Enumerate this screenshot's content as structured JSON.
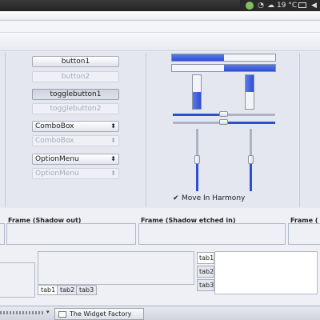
{
  "system_panel": {
    "temperature": "19 °C",
    "tray_icons": [
      "network-icon",
      "wifi-icon",
      "weather-icon",
      "mail-icon",
      "volume-icon"
    ]
  },
  "buttons": {
    "button1": "button1",
    "button2": "button2",
    "togglebutton1": "togglebutton1",
    "togglebutton2": "togglebutton2"
  },
  "combos": {
    "combobox1": "ComboBox",
    "combobox2": "ComboBox",
    "optionmenu1": "OptionMenu",
    "optionmenu2": "OptionMenu"
  },
  "progress": {
    "hbar1_fraction": 0.5,
    "hbar2_fraction": 0.5,
    "vbar1_fraction": 0.5,
    "vbar2_fraction": 0.5
  },
  "scales": {
    "hscale1_value": 0.5,
    "hscale2_value": 0.5,
    "vscale1_value": 0.5,
    "vscale2_value": 0.5
  },
  "harmony": {
    "label": "Move In Harmony",
    "checked": true
  },
  "frames": {
    "shadow_out": "Frame (Shadow out)",
    "shadow_etched_in": "Frame (Shadow etched in)",
    "frame_right": "Frame ("
  },
  "tabs_bottom": [
    "tab1",
    "tab2",
    "tab3"
  ],
  "tabs_right": [
    "tab1",
    "tab2",
    "tab3"
  ],
  "taskbar": {
    "window_title": "The Widget Factory"
  },
  "colors": {
    "accent": "#2d4fd4",
    "panel_dark": "#2a2a2a",
    "window_bg": "#e4e7f0"
  }
}
